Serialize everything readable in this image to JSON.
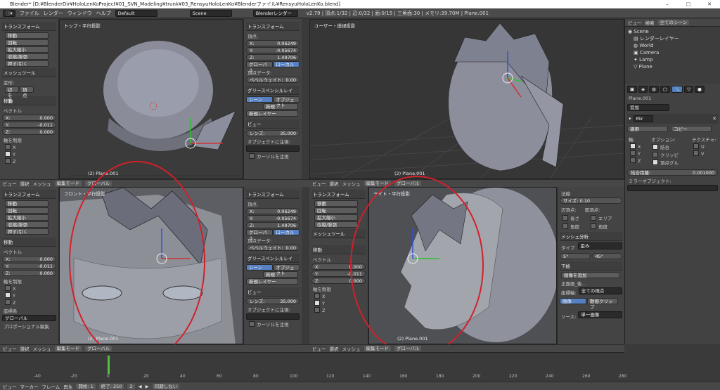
{
  "window": {
    "title": "Blender* [D:¥BlenderDir¥HoloLenKoProject¥01_SVN_Modeling¥trunk¥03_RensyuHoloLenKo¥Blenderファイル¥RensyuHoloLenKo.blend]"
  },
  "menubar": {
    "items": [
      "ファイル",
      "レンダー",
      "ウィンドウ",
      "ヘルプ"
    ],
    "layout": "Default",
    "scene": "Scene",
    "engine": "Blenderレンダー",
    "stats": "v2.79 | 頂点:1/32 | 辺:0/32 | 面:0/15 | 三角面:30 | メモリ:39.70M | Plane.001"
  },
  "tool_panel": {
    "transform_header": "トランスフォーム",
    "buttons": [
      "移動",
      "回転",
      "拡大縮小",
      "収縮/膨張",
      "押す/引く"
    ],
    "mesh_tools": "メッシュツール",
    "deform": "変形:",
    "deform_btns": [
      "辺を滑",
      "頂点"
    ],
    "move_op": "移動",
    "vector": "ベクトル",
    "x": "X:",
    "xv": "0.000",
    "y": "Y:",
    "yv": "-0.011",
    "z": "Z:",
    "zv": "0.000",
    "axis_constraint": "軸を制限",
    "cx": "X",
    "cy": "Y",
    "cz": "Z",
    "coord": "座標系",
    "coord_val": "グローバル",
    "prop_edit": "プロポーショナル編集"
  },
  "nprop": {
    "transform": "トランスフォーム",
    "vertex": "頂点:",
    "vx": "X:",
    "vxv": "0.06249",
    "vy": "Y:",
    "vyv": "-0.05674",
    "vz": "Z:",
    "vzv": "1.49706",
    "global": "グローバル",
    "local": "ローカル",
    "vdata": "頂点データ:",
    "bevel": "ベベルウェイト:",
    "bevelv": "0.00",
    "gp": "グリースペンシルレイ",
    "scene": "シーン",
    "object": "オブジェクト",
    "new": "新規",
    "new_layer": "新規レイヤー",
    "view": "ビュー",
    "lens": "レンズ:",
    "lensv": "35.000",
    "lock": "オブジェクトに注視:",
    "cursor": "カーソルを注視"
  },
  "viewports": {
    "top_left": "トップ・平行投影",
    "top_right": "ユーザー・透視投影",
    "bottom_left": "フロント・平行投影",
    "bottom_right": "ライト・平行投影",
    "object": "(2) Plane.001"
  },
  "vp_header": {
    "items": [
      "ビュー",
      "選択",
      "メッシュ"
    ],
    "mode": "編集モード",
    "pivot": "グローバル"
  },
  "right_vp_panel": {
    "method": "法線",
    "size": "サイズ: 0.10",
    "edges": "辺頂点:",
    "faces": "面頂点:",
    "length": "長さ",
    "area": "エリア",
    "angle": "角度",
    "angle2": "角度",
    "mesh_analysis": "メッシュ分析",
    "type": "タイプ",
    "type_v": "歪み",
    "deg1": "5°",
    "deg2": "45°",
    "background": "下絵",
    "add_image": "画像を追加",
    "front": "正面画_後...",
    "axis": "座標軸:",
    "axis_v": "全ての視点",
    "image": "画像",
    "movie": "動画クリップ",
    "source": "ソース:",
    "source_v": "単一画像"
  },
  "outliner": {
    "view": "ビュー",
    "search": "検索",
    "filter": "全てのシーン",
    "items": [
      "Scene",
      "レンダーレイヤー",
      "World",
      "Camera",
      "Lamp",
      "Plane"
    ]
  },
  "properties": {
    "object": "Plane.001",
    "add": "追加",
    "modifier": "Mir",
    "apply": "適用",
    "copy": "コピー",
    "axis": "軸:",
    "options": "オプション:",
    "texture": "テクスチャ:",
    "ax": "X",
    "ay": "Y",
    "az": "Z",
    "merge": "結合",
    "clip": "クリッピ",
    "vgroup": "頂点グル",
    "u": "U",
    "v": "V",
    "merge_dist": "結合距離:",
    "merge_dist_v": "0.001000",
    "mirror_obj": "ミラーオブジェクト:"
  },
  "timeline": {
    "menu": [
      "ビュー",
      "マーカー",
      "フレーム",
      "再生"
    ],
    "start": "開始:",
    "start_v": "1",
    "end": "終了:",
    "end_v": "250",
    "current": "2",
    "sync": "同期しない",
    "ticks": [
      "-40",
      "-20",
      "0",
      "20",
      "40",
      "60",
      "80",
      "100",
      "120",
      "140",
      "160",
      "180",
      "200",
      "220",
      "240",
      "260",
      "280"
    ]
  }
}
